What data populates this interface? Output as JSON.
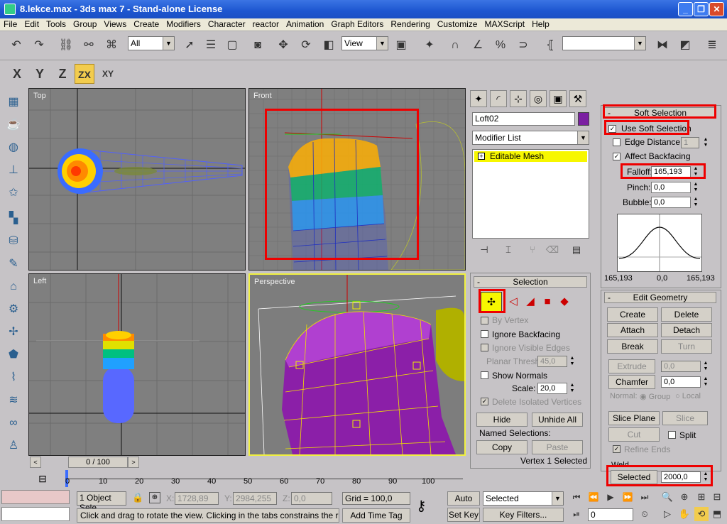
{
  "window": {
    "title": "8.lekce.max - 3ds max 7  - Stand-alone License",
    "minimize": "_",
    "maximize": "❐",
    "close": "✕"
  },
  "menu": [
    "File",
    "Edit",
    "Tools",
    "Group",
    "Views",
    "Create",
    "Modifiers",
    "Character",
    "reactor",
    "Animation",
    "Graph Editors",
    "Rendering",
    "Customize",
    "MAXScript",
    "Help"
  ],
  "toolbar": {
    "selection_filter": "All",
    "ref_coord": "View",
    "named_sel": ""
  },
  "axis": {
    "x": "X",
    "y": "Y",
    "z": "Z",
    "zx": "ZX",
    "xy": "XY"
  },
  "viewports": {
    "top": "Top",
    "front": "Front",
    "left": "Left",
    "perspective": "Perspective"
  },
  "timeline": {
    "frame_display": "0 / 100",
    "ticks": [
      "0",
      "10",
      "20",
      "30",
      "40",
      "50",
      "60",
      "70",
      "80",
      "90",
      "100"
    ]
  },
  "command_panel": {
    "object_name": "Loft02",
    "object_color": "#7b1fa2",
    "modifier_list": "Modifier List",
    "stack_item": "Editable Mesh",
    "selection": {
      "header": "Selection",
      "by_vertex": "By Vertex",
      "ignore_backfacing": "Ignore Backfacing",
      "ignore_visible_edges": "Ignore Visible Edges",
      "planar_thresh_label": "Planar Thresh:",
      "planar_thresh_value": "45,0",
      "show_normals": "Show Normals",
      "scale_label": "Scale:",
      "scale_value": "20,0",
      "delete_isolated": "Delete Isolated Vertices",
      "hide": "Hide",
      "unhide_all": "Unhide All",
      "named_selections": "Named Selections:",
      "copy": "Copy",
      "paste": "Paste",
      "status": "Vertex 1 Selected"
    },
    "soft_selection": {
      "header": "Soft Selection",
      "use_soft_selection": "Use Soft Selection",
      "edge_distance": "Edge Distance:",
      "edge_distance_value": "1",
      "affect_backfacing": "Affect Backfacing",
      "falloff_label": "Falloff:",
      "falloff_value": "165,193",
      "pinch_label": "Pinch:",
      "pinch_value": "0,0",
      "bubble_label": "Bubble:",
      "bubble_value": "0,0",
      "curve_left": "165,193",
      "curve_mid": "0,0",
      "curve_right": "165,193"
    },
    "edit_geometry": {
      "header": "Edit Geometry",
      "create": "Create",
      "delete": "Delete",
      "attach": "Attach",
      "detach": "Detach",
      "break": "Break",
      "turn": "Turn",
      "extrude": "Extrude",
      "extrude_value": "0,0",
      "chamfer": "Chamfer",
      "chamfer_value": "0,0",
      "normal_label": "Normal:",
      "group": "Group",
      "local": "Local",
      "slice_plane": "Slice Plane",
      "slice": "Slice",
      "cut": "Cut",
      "split": "Split",
      "refine_ends": "Refine Ends",
      "weld": "Weld",
      "selected": "Selected",
      "weld_value": "2000,0"
    }
  },
  "status": {
    "objects": "1 Object Sele",
    "x_label": "X:",
    "x": "1728,89",
    "y_label": "Y:",
    "y": "2984,255",
    "z_label": "Z:",
    "z": "0,0",
    "grid": "Grid = 100,0",
    "prompt": "Click and drag to rotate the view.  Clicking in the tabs constrains the rotation",
    "add_time_tag": "Add Time Tag",
    "auto_key": "Auto Key",
    "set_key": "Set Key",
    "key_mode": "Selected",
    "key_filters": "Key Filters...",
    "frame": "0"
  }
}
